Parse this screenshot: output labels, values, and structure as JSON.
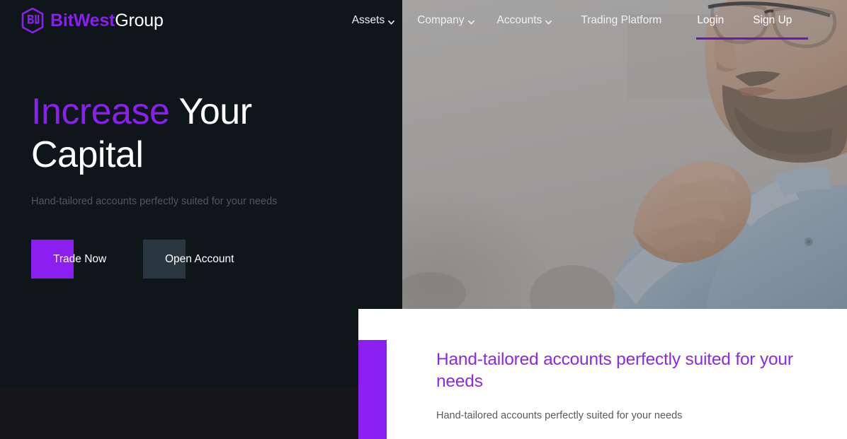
{
  "brand": {
    "logo_icon": "bitwest-hexagon-bw-logo",
    "name_accent": "BitWest",
    "name_plain": "Group",
    "accent_color": "#8b1ff0"
  },
  "nav": {
    "items": [
      {
        "label": "Assets",
        "has_dropdown": true,
        "icon": "chevron-down-icon"
      },
      {
        "label": "Company",
        "has_dropdown": true,
        "icon": "chevron-down-icon"
      },
      {
        "label": "Accounts",
        "has_dropdown": true,
        "icon": "chevron-down-icon"
      },
      {
        "label": "Trading Platform",
        "has_dropdown": false
      }
    ],
    "auth": [
      {
        "label": "Login",
        "underline_color": "#6a17b8"
      },
      {
        "label": "Sign Up",
        "underline_color": "#6a17b8"
      }
    ]
  },
  "hero": {
    "title_accent": "Increase",
    "title_rest": " Your Capital",
    "subtitle": "Hand-tailored accounts perfectly suited for your needs",
    "buttons": [
      {
        "label": "Trade Now",
        "color": "#8b1ff0"
      },
      {
        "label": "Open Account",
        "color": "#2b3740"
      }
    ],
    "photo_alt": "bearded-man-with-glasses-hand-on-chin-in-light-blue-shirt"
  },
  "panel": {
    "accent_bar_color": "#8b1ff0",
    "heading": "Hand-tailored accounts perfectly suited for your needs",
    "body": "Hand-tailored accounts perfectly suited for your needs"
  }
}
